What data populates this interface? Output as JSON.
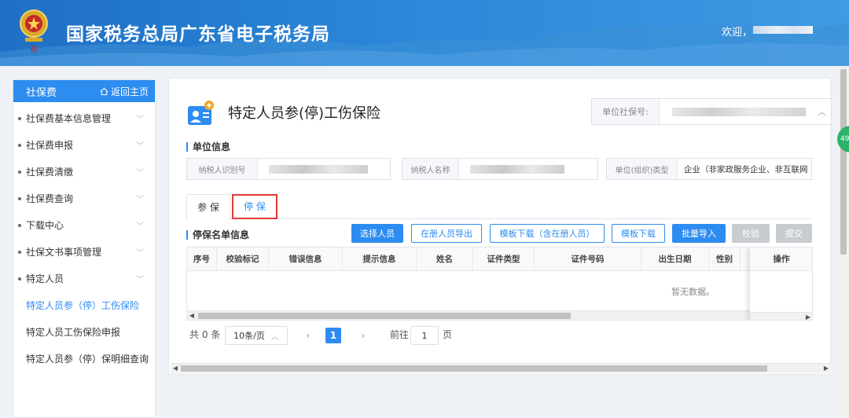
{
  "header": {
    "site_title": "国家税务总局广东省电子税务局",
    "welcome": "欢迎，"
  },
  "sidebar": {
    "title": "社保费",
    "home_label": "返回主页",
    "items": [
      {
        "label": "社保费基本信息管理"
      },
      {
        "label": "社保费申报"
      },
      {
        "label": "社保费清缴"
      },
      {
        "label": "社保费查询"
      },
      {
        "label": "下载中心"
      },
      {
        "label": "社保文书事项管理"
      },
      {
        "label": "特定人员"
      }
    ],
    "sub_items": [
      {
        "label": "特定人员参（停）工伤保险",
        "active": true
      },
      {
        "label": "特定人员工伤保险申报"
      },
      {
        "label": "特定人员参（停）保明细查询"
      }
    ]
  },
  "page": {
    "title": "特定人员参(停)工伤保险",
    "unit_ss_label": "单位社保号:"
  },
  "unit_info": {
    "section_title": "单位信息",
    "taxpayer_id_label": "纳税人识别号",
    "taxpayer_name_label": "纳税人名称",
    "org_type_label": "单位(组织)类型",
    "org_type_value": "企业（非家政服务企业、非互联网"
  },
  "tabs": [
    {
      "label": "参 保"
    },
    {
      "label": "停 保"
    }
  ],
  "list": {
    "section_title": "停保名单信息",
    "buttons": {
      "select_person": "选择人员",
      "export_registered": "在册人员导出",
      "template_with_registered": "模板下载（含在册人员）",
      "template": "模板下载",
      "batch_import": "批量导入",
      "validate": "校验",
      "submit": "提交"
    },
    "columns": [
      "序号",
      "校验标记",
      "错误信息",
      "提示信息",
      "姓名",
      "证件类型",
      "证件号码",
      "出生日期",
      "性别"
    ],
    "action_column": "操作",
    "empty_text": "暂无数据。"
  },
  "pagination": {
    "total_prefix": "共",
    "total": "0",
    "total_suffix": "条",
    "page_size": "10条/页",
    "current_page": "1",
    "goto_prefix": "前往",
    "goto_value": "1",
    "goto_suffix": "页"
  },
  "float_badge": "49",
  "colors": {
    "primary": "#2d8cf0",
    "header": "#2a86d8",
    "highlight_border": "#e53935"
  }
}
